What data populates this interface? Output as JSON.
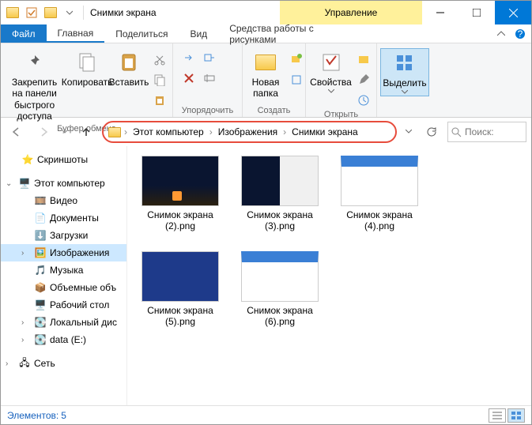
{
  "title": "Снимки экрана",
  "contextual_tab": "Управление",
  "tabs": {
    "file": "Файл",
    "home": "Главная",
    "share": "Поделиться",
    "view": "Вид",
    "picture": "Средства работы с рисунками"
  },
  "ribbon": {
    "pin": "Закрепить на панели\nбыстрого доступа",
    "copy": "Копировать",
    "paste": "Вставить",
    "g_clipboard": "Буфер обмена",
    "g_organize": "Упорядочить",
    "new_folder": "Новая\nпапка",
    "g_create": "Создать",
    "properties": "Свойства",
    "g_open": "Открыть",
    "select": "Выделить"
  },
  "breadcrumb": [
    "Этот компьютер",
    "Изображения",
    "Снимки экрана"
  ],
  "search_placeholder": "Поиск: ",
  "sidebar": {
    "screenshots": "Скриншоты",
    "this_pc": "Этот компьютер",
    "videos": "Видео",
    "documents": "Документы",
    "downloads": "Загрузки",
    "pictures": "Изображения",
    "music": "Музыка",
    "volumes": "Объемные объ",
    "desktop": "Рабочий стол",
    "localdisk": "Локальный дис",
    "data": "data (E:)",
    "network": "Сеть"
  },
  "files": [
    {
      "name": "Снимок экрана (2).png",
      "kind": "dark"
    },
    {
      "name": "Снимок экрана (3).png",
      "kind": "mix"
    },
    {
      "name": "Снимок экрана (4).png",
      "kind": "app"
    },
    {
      "name": "Снимок экрана (5).png",
      "kind": "tiles"
    },
    {
      "name": "Снимок экрана (6).png",
      "kind": "app"
    }
  ],
  "status": {
    "count_label": "Элементов:",
    "count": "5"
  }
}
